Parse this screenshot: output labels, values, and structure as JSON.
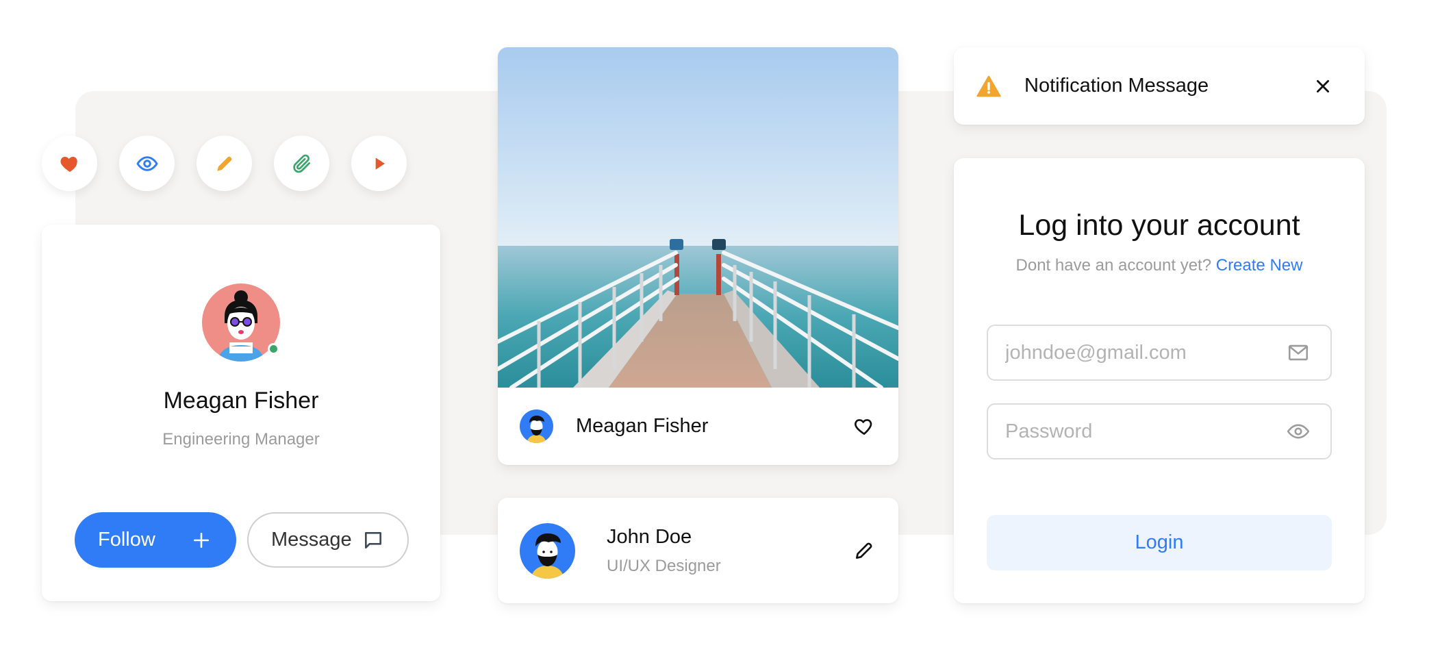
{
  "icon_buttons": [
    {
      "icon": "heart-icon",
      "color": "#e4582b"
    },
    {
      "icon": "eye-icon",
      "color": "#2f7cf6"
    },
    {
      "icon": "pencil-icon",
      "color": "#f0a52f"
    },
    {
      "icon": "paperclip-icon",
      "color": "#3aa56b"
    },
    {
      "icon": "play-icon",
      "color": "#e4582b"
    }
  ],
  "profile": {
    "name": "Meagan Fisher",
    "role": "Engineering Manager",
    "status": "online",
    "follow_label": "Follow",
    "message_label": "Message"
  },
  "photo_card": {
    "author": "Meagan Fisher",
    "liked": false
  },
  "user_card": {
    "name": "John Doe",
    "role": "UI/UX Designer"
  },
  "notification": {
    "text": "Notification Message",
    "icon": "warning-icon",
    "icon_color": "#f0a52f"
  },
  "login": {
    "title": "Log into your account",
    "prompt": "Dont have an account yet?",
    "create_link": "Create New",
    "email_placeholder": "johndoe@gmail.com",
    "password_placeholder": "Password",
    "submit_label": "Login"
  },
  "colors": {
    "accent": "#2f7cf6",
    "backdrop": "#f5f4f2",
    "muted_text": "#9b9b9b"
  }
}
